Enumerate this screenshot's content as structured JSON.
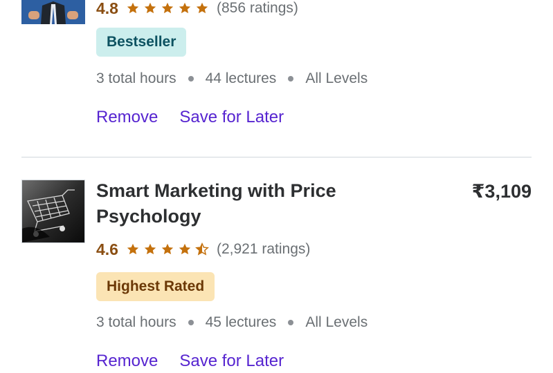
{
  "colors": {
    "rating": "#8a4e12",
    "star": "#c4710d",
    "link": "#5624d0",
    "bestseller_bg": "#cceeed",
    "bestseller_text": "#0d5261",
    "highest_rated_bg": "#fbe4b4",
    "highest_rated_text": "#6b3806",
    "divider": "#d1d7dc"
  },
  "courses": [
    {
      "title": "",
      "price": "",
      "rating": "4.8",
      "stars": 5,
      "ratings_count": "(856 ratings)",
      "badge": "Bestseller",
      "hours": "3 total hours",
      "lectures": "44 lectures",
      "level": "All Levels",
      "remove_label": "Remove",
      "save_label": "Save for Later"
    },
    {
      "title": "Smart Marketing with Price Psychology",
      "price": "₹3,109",
      "rating": "4.6",
      "stars": 4.5,
      "ratings_count": "(2,921 ratings)",
      "badge": "Highest Rated",
      "hours": "3 total hours",
      "lectures": "45 lectures",
      "level": "All Levels",
      "remove_label": "Remove",
      "save_label": "Save for Later"
    }
  ]
}
